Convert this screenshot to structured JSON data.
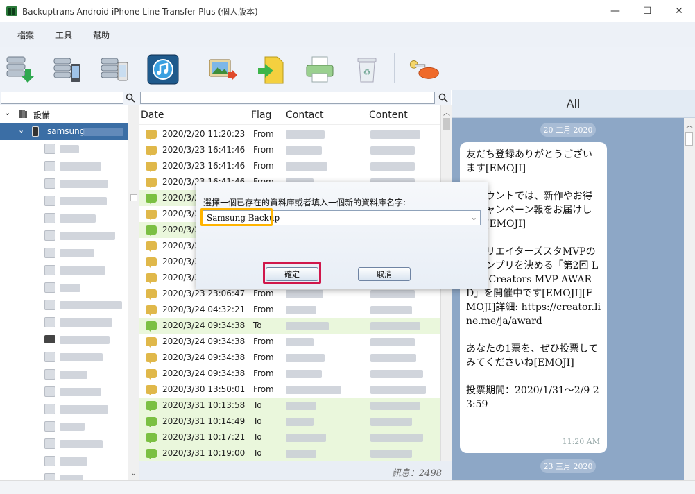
{
  "window": {
    "title": "Backuptrans Android iPhone Line Transfer Plus (個人版本)",
    "controls": [
      "—",
      "☐",
      "✕"
    ]
  },
  "menu": [
    "檔案",
    "工具",
    "幫助"
  ],
  "toolbar": [
    "backup-device-icon",
    "transfer-to-phone-icon",
    "transfer-between-phones-icon",
    "itunes-restore-icon",
    "export-photos-icon",
    "export-file-icon",
    "print-icon",
    "delete-icon",
    "key-icon"
  ],
  "tree": {
    "root_label": "設備",
    "device_label": "samsung",
    "contact_count": 21
  },
  "table": {
    "columns": {
      "date": "Date",
      "flag": "Flag",
      "contact": "Contact",
      "content": "Content"
    },
    "rows": [
      {
        "date": "2020/2/20 11:20:23",
        "flag": "From",
        "dir": "from"
      },
      {
        "date": "2020/3/23 16:41:46",
        "flag": "From",
        "dir": "from"
      },
      {
        "date": "2020/3/23 16:41:46",
        "flag": "From",
        "dir": "from"
      },
      {
        "date": "2020/3/23 16:41:46",
        "flag": "From",
        "dir": "from"
      },
      {
        "date": "2020/3/2",
        "flag": "",
        "dir": "to"
      },
      {
        "date": "2020/3/2",
        "flag": "",
        "dir": "from"
      },
      {
        "date": "2020/3/2",
        "flag": "",
        "dir": "to"
      },
      {
        "date": "2020/3/2",
        "flag": "",
        "dir": "from"
      },
      {
        "date": "2020/3/2",
        "flag": "",
        "dir": "from"
      },
      {
        "date": "2020/3/2",
        "flag": "",
        "dir": "from"
      },
      {
        "date": "2020/3/23 23:06:47",
        "flag": "From",
        "dir": "from"
      },
      {
        "date": "2020/3/24 04:32:21",
        "flag": "From",
        "dir": "from"
      },
      {
        "date": "2020/3/24 09:34:38",
        "flag": "To",
        "dir": "to"
      },
      {
        "date": "2020/3/24 09:34:38",
        "flag": "From",
        "dir": "from"
      },
      {
        "date": "2020/3/24 09:34:38",
        "flag": "From",
        "dir": "from"
      },
      {
        "date": "2020/3/24 09:34:38",
        "flag": "From",
        "dir": "from"
      },
      {
        "date": "2020/3/30 13:50:01",
        "flag": "From",
        "dir": "from"
      },
      {
        "date": "2020/3/31 10:13:58",
        "flag": "To",
        "dir": "to"
      },
      {
        "date": "2020/3/31 10:14:49",
        "flag": "To",
        "dir": "to"
      },
      {
        "date": "2020/3/31 10:17:21",
        "flag": "To",
        "dir": "to"
      },
      {
        "date": "2020/3/31 10:19:00",
        "flag": "To",
        "dir": "to"
      }
    ],
    "status": "訊息：2498"
  },
  "chat": {
    "header": "All",
    "date1": "20 二月 2020",
    "date2": "23 三月 2020",
    "bubble": {
      "paragraphs": [
        "友だち登録ありがとうございます[EMOJI]",
        "アカウントでは、新作やお得なキャンペーン報をお届けします[EMOJI]",
        "、クリエイターズスタMVPのグランプリを決める「第2回 LINE Creators MVP AWARD」を開催中です[EMOJI][EMOJI]詳細: https://creator.line.me/ja/award",
        "あなたの1票を、ぜひ投票してみてくださいね[EMOJI]",
        "投票期間：2020/1/31～2/9 23:59"
      ],
      "time": "11:20 AM"
    }
  },
  "dialog": {
    "prompt": "選擇一個已存在的資料庫或者填入一個新的資料庫名字:",
    "value": "Samsung Backup",
    "ok": "確定",
    "cancel": "取消"
  },
  "colors": {
    "selected": "#3b6ea5",
    "to_row": "#eaf7dc",
    "chat_bg": "#8da7c6",
    "highlight_yellow": "#ffb400",
    "highlight_red": "#d0174b"
  }
}
